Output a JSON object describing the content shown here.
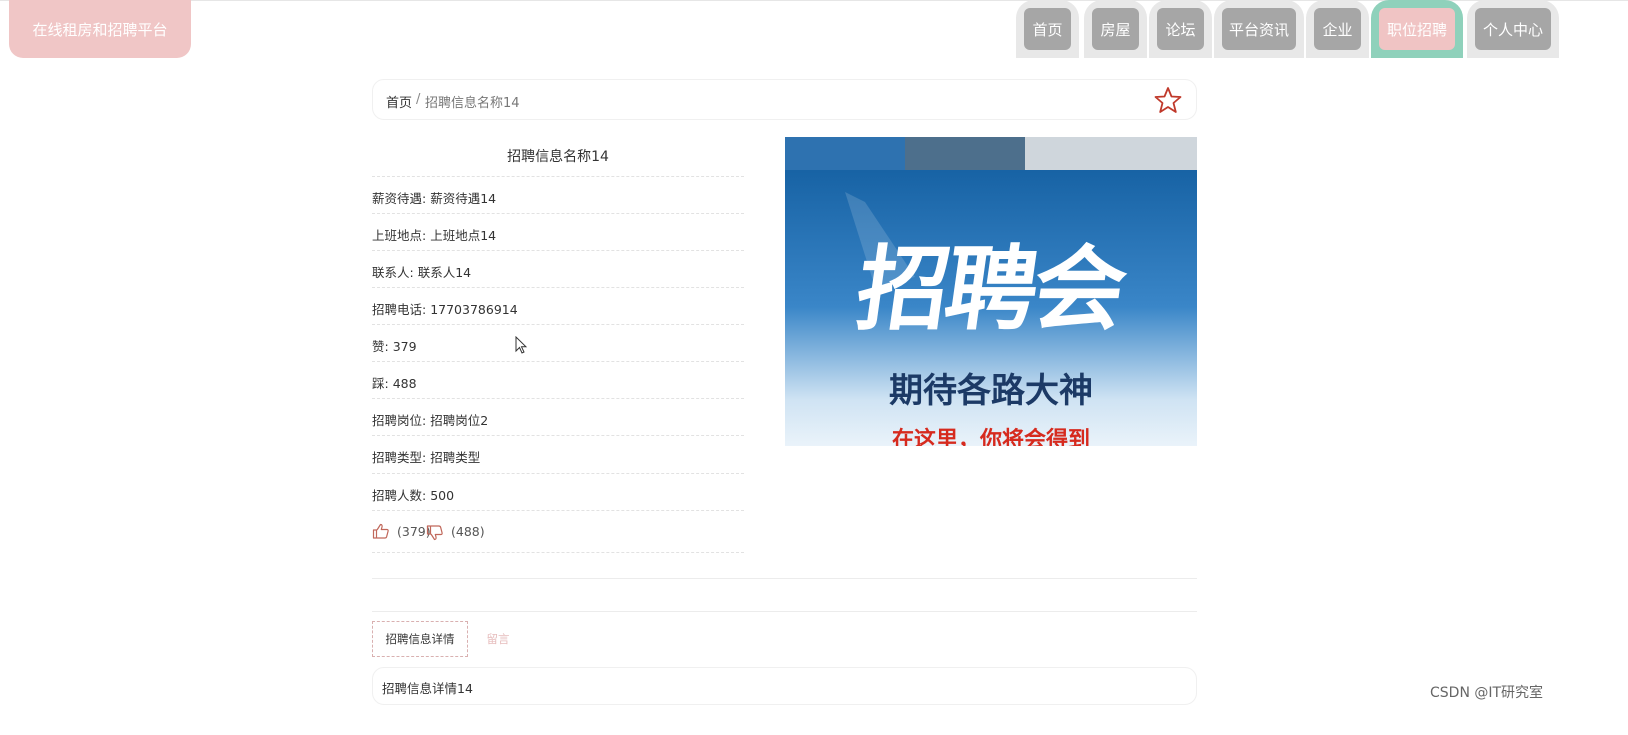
{
  "header": {
    "logo": "在线租房和招聘平台",
    "nav": [
      "首页",
      "房屋",
      "论坛",
      "平台资讯",
      "企业",
      "职位招聘",
      "个人中心"
    ],
    "active_nav": "职位招聘"
  },
  "breadcrumb": {
    "home": "首页",
    "separator": "/",
    "current": "招聘信息名称14"
  },
  "detail": {
    "title": "招聘信息名称14",
    "fields": [
      {
        "label": "薪资待遇",
        "value": "薪资待遇14"
      },
      {
        "label": "上班地点",
        "value": "上班地点14"
      },
      {
        "label": "联系人",
        "value": "联系人14"
      },
      {
        "label": "招聘电话",
        "value": "17703786914"
      },
      {
        "label": "赞",
        "value": "379"
      },
      {
        "label": "踩",
        "value": "488"
      },
      {
        "label": "招聘岗位",
        "value": "招聘岗位2"
      },
      {
        "label": "招聘类型",
        "value": "招聘类型"
      },
      {
        "label": "招聘人数",
        "value": "500"
      }
    ],
    "like_count": "(379)",
    "dislike_count": "(488)"
  },
  "poster": {
    "headline": "招聘会",
    "subline": "期待各路大神",
    "footer": "在这里，你将会得到"
  },
  "tabs": [
    "招聘信息详情",
    "留言"
  ],
  "tab_content": "招聘信息详情14",
  "watermark": "CSDN @IT研究室",
  "colors": {
    "logo_bg": "#f0c6c6",
    "nav_btn": "#a6a6a6",
    "nav_active": "#f0c4c4",
    "nav_active_border": "#8fd1bb",
    "star": "#c0392b"
  },
  "icons": {
    "favorite": "star-outline-icon",
    "like": "thumbs-up-icon",
    "dislike": "thumbs-down-icon"
  }
}
